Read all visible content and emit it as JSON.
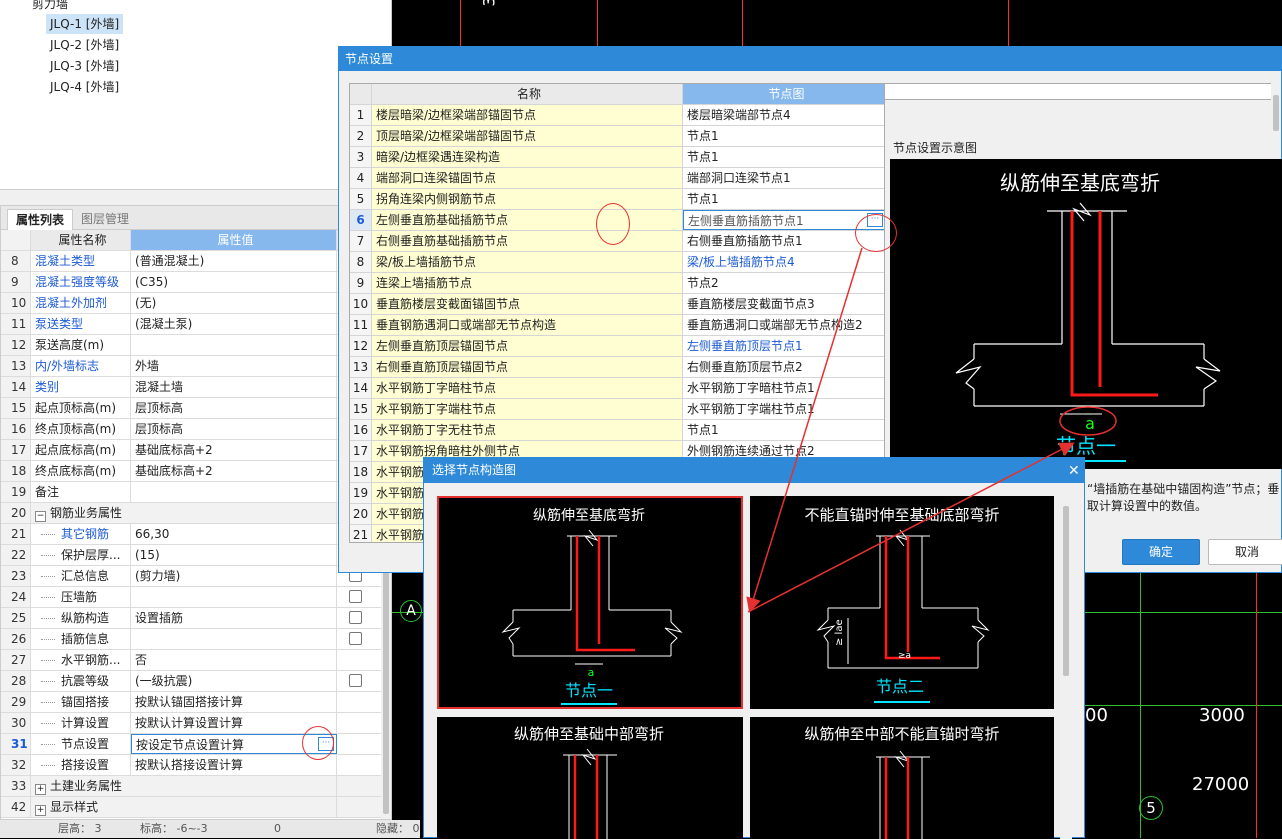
{
  "tree": {
    "parent": "剪力墙",
    "items": [
      "JLQ-1 [外墙]",
      "JLQ-2 [外墙]",
      "JLQ-3 [外墙]",
      "JLQ-4 [外墙]"
    ]
  },
  "props": {
    "tabs": [
      "属性列表",
      "图层管理"
    ],
    "header": {
      "name": "属性名称",
      "value": "属性值"
    },
    "rows": [
      {
        "num": "8",
        "name": "混凝土类型",
        "value": "(普通混凝土)",
        "blue": true
      },
      {
        "num": "9",
        "name": "混凝土强度等级",
        "value": "(C35)",
        "blue": true
      },
      {
        "num": "10",
        "name": "混凝土外加剂",
        "value": "(无)",
        "blue": true
      },
      {
        "num": "11",
        "name": "泵送类型",
        "value": "(混凝土泵)",
        "blue": true
      },
      {
        "num": "12",
        "name": "泵送高度(m)",
        "value": "",
        "blue": false
      },
      {
        "num": "13",
        "name": "内/外墙标志",
        "value": "外墙",
        "blue": true
      },
      {
        "num": "14",
        "name": "类别",
        "value": "混凝土墙",
        "blue": true
      },
      {
        "num": "15",
        "name": "起点顶标高(m)",
        "value": "层顶标高",
        "blue": false
      },
      {
        "num": "16",
        "name": "终点顶标高(m)",
        "value": "层顶标高",
        "blue": false
      },
      {
        "num": "17",
        "name": "起点底标高(m)",
        "value": "基础底标高+2",
        "blue": false
      },
      {
        "num": "18",
        "name": "终点底标高(m)",
        "value": "基础底标高+2",
        "blue": false
      },
      {
        "num": "19",
        "name": "备注",
        "value": "",
        "blue": false
      },
      {
        "num": "20",
        "name": "钢筋业务属性",
        "value": "",
        "blue": false,
        "group": true,
        "sign": "−"
      },
      {
        "num": "21",
        "name": "其它钢筋",
        "value": "66,30",
        "blue": true,
        "indent": true
      },
      {
        "num": "22",
        "name": "保护层厚...",
        "value": "(15)",
        "blue": false,
        "indent": true
      },
      {
        "num": "23",
        "name": "汇总信息",
        "value": "(剪力墙)",
        "blue": false,
        "indent": true,
        "check": true
      },
      {
        "num": "24",
        "name": "压墙筋",
        "value": "",
        "blue": false,
        "indent": true,
        "check": true
      },
      {
        "num": "25",
        "name": "纵筋构造",
        "value": "设置插筋",
        "blue": false,
        "indent": true,
        "check": true
      },
      {
        "num": "26",
        "name": "插筋信息",
        "value": "",
        "blue": false,
        "indent": true,
        "check": true
      },
      {
        "num": "27",
        "name": "水平钢筋...",
        "value": "否",
        "blue": false,
        "indent": true
      },
      {
        "num": "28",
        "name": "抗震等级",
        "value": "(一级抗震)",
        "blue": false,
        "indent": true,
        "check": true
      },
      {
        "num": "29",
        "name": "锚固搭接",
        "value": "按默认锚固搭接计算",
        "blue": false,
        "indent": true
      },
      {
        "num": "30",
        "name": "计算设置",
        "value": "按默认计算设置计算",
        "blue": false,
        "indent": true
      },
      {
        "num": "31",
        "name": "节点设置",
        "value": "按设定节点设置计算",
        "blue": false,
        "indent": true,
        "selected": true
      },
      {
        "num": "32",
        "name": "搭接设置",
        "value": "按默认搭接设置计算",
        "blue": false,
        "indent": true
      },
      {
        "num": "33",
        "name": "土建业务属性",
        "value": "",
        "blue": false,
        "group": true,
        "sign": "+"
      },
      {
        "num": "42",
        "name": "显示样式",
        "value": "",
        "blue": false,
        "group": true,
        "sign": "+"
      }
    ],
    "ellipsis": "···"
  },
  "status": {
    "floor": "层高：  3",
    "elev": "标高：  -6~-3",
    "zero": "0",
    "hidden": "隐藏：  0"
  },
  "cad": {
    "label_a": "A",
    "label_5": "5",
    "label_3": "3",
    "num_left": "00",
    "num_3000": "3000",
    "num_27000": "27000"
  },
  "dlg": {
    "title": "节点设置",
    "header": {
      "name": "名称",
      "value": "节点图"
    },
    "rows": [
      {
        "num": "1",
        "name": "楼层暗梁/边框梁端部锚固节点",
        "value": "楼层暗梁端部节点4"
      },
      {
        "num": "2",
        "name": "顶层暗梁/边框梁端部锚固节点",
        "value": "节点1"
      },
      {
        "num": "3",
        "name": "暗梁/边框梁遇连梁构造",
        "value": "节点1"
      },
      {
        "num": "4",
        "name": "端部洞口连梁锚固节点",
        "value": "端部洞口连梁节点1"
      },
      {
        "num": "5",
        "name": "拐角连梁内侧钢筋节点",
        "value": "节点1"
      },
      {
        "num": "6",
        "name": "左侧垂直筋基础插筋节点",
        "value": "左侧垂直筋插筋节点1",
        "selected": true
      },
      {
        "num": "7",
        "name": "右侧垂直筋基础插筋节点",
        "value": "右侧垂直筋插筋节点1"
      },
      {
        "num": "8",
        "name": "梁/板上墙插筋节点",
        "value": "梁/板上墙插筋节点4",
        "blue": true
      },
      {
        "num": "9",
        "name": "连梁上墙插筋节点",
        "value": "节点2"
      },
      {
        "num": "10",
        "name": "垂直筋楼层变截面锚固节点",
        "value": "垂直筋楼层变截面节点3"
      },
      {
        "num": "11",
        "name": "垂直钢筋遇洞口或端部无节点构造",
        "value": "垂直筋遇洞口或端部无节点构造2"
      },
      {
        "num": "12",
        "name": "左侧垂直筋顶层锚固节点",
        "value": "左侧垂直筋顶层节点1",
        "blue": true
      },
      {
        "num": "13",
        "name": "右侧垂直筋顶层锚固节点",
        "value": "右侧垂直筋顶层节点2"
      },
      {
        "num": "14",
        "name": "水平钢筋丁字暗柱节点",
        "value": "水平钢筋丁字暗柱节点1"
      },
      {
        "num": "15",
        "name": "水平钢筋丁字端柱节点",
        "value": "水平钢筋丁字端柱节点1"
      },
      {
        "num": "16",
        "name": "水平钢筋丁字无柱节点",
        "value": "节点1"
      },
      {
        "num": "17",
        "name": "水平钢筋拐角暗柱外侧节点",
        "value": "外侧钢筋连续通过节点2"
      },
      {
        "num": "18",
        "name": "水平钢筋",
        "value": ""
      },
      {
        "num": "19",
        "name": "水平钢筋",
        "value": ""
      },
      {
        "num": "20",
        "name": "水平钢筋",
        "value": ""
      },
      {
        "num": "21",
        "name": "水平钢筋",
        "value": ""
      }
    ],
    "preview_label": "节点设置示意图",
    "preview_title": "纵筋伸至基底弯折",
    "preview_a": "a",
    "preview_node": "节点一",
    "desc_line1": "“墙插筋在基础中锚固构造”节点；垂",
    "desc_line2": "取计算设置中的数值。",
    "ok": "确定",
    "cancel": "取消"
  },
  "dlg2": {
    "title": "选择节点构造图",
    "cards": [
      {
        "title": "纵筋伸至基底弯折",
        "node": "节点一",
        "a": "a"
      },
      {
        "title": "不能直锚时伸至基础底部弯折",
        "node": "节点二",
        "a": "a",
        "lae": "≥ lae",
        "a2": "≥a"
      },
      {
        "title": "纵筋伸至基础中部弯折"
      },
      {
        "title": "纵筋伸至中部不能直锚时弯折"
      }
    ]
  },
  "colors": {
    "accent": "#2e8ad8",
    "red": "#e53030",
    "rebar": "#ff1a1a",
    "cyan": "#00e5ff",
    "cad_green": "#2fbf2f"
  }
}
